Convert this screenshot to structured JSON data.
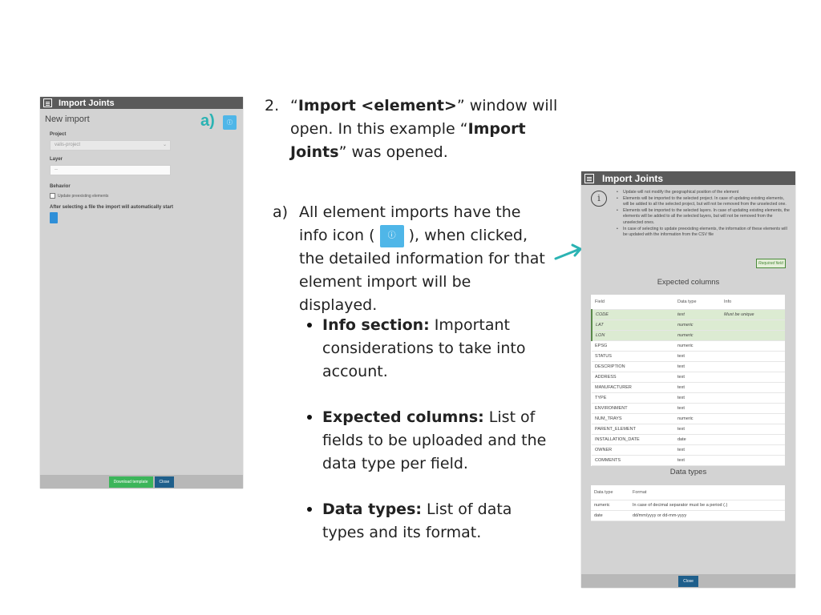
{
  "left_window": {
    "title": "Import Joints",
    "subtitle": "New import",
    "project_label": "Project",
    "project_value": "valis-project",
    "layer_label": "Layer",
    "layer_value": "--",
    "behavior_label": "Behavior",
    "checkbox_label": "Update preexisting elements",
    "auto_text": "After selecting a file the import will automatically start",
    "annotation": "a)",
    "download_label": "Download template",
    "close_label": "Close"
  },
  "step2": {
    "number": "2.",
    "t1": "“",
    "b1": "Import <element>",
    "t2": "” window will open. In this example “",
    "b2": "Import Joints",
    "t3": "” was opened."
  },
  "stepa": {
    "number": "a)",
    "t1": "All element imports have the info icon (",
    "t2": "), when clicked, the detailed information for that element import will be displayed."
  },
  "bullets": [
    {
      "bold": "Info section:",
      "text": " Important considerations to take into account."
    },
    {
      "bold": "Expected columns:",
      "text": " List of fields to be uploaded and the data type per field."
    },
    {
      "bold": "Data types:",
      "text": " List of data types and its format."
    }
  ],
  "right_window": {
    "title": "Import Joints",
    "info_items": [
      "Update will not modify the geographical position of the element",
      "Elements will be imported to the selected project. In case of updating existing elements, will be added to all the selected project, but will not be removed from the unselected one.",
      "Elements will be imported to the selected layers. In case of updating existing elements, the elements will be added to all the selected layers, but will not be removed from the unselected ones.",
      "In case of selecting to update preexisting elements, the information of these elements will be updated with the information from the CSV file"
    ],
    "required_field": "Required field",
    "expected_title": "Expected columns",
    "columns_header": [
      "Field",
      "Data type",
      "Info"
    ],
    "columns": [
      {
        "field": "CODE",
        "type": "text",
        "info": "Must be unique",
        "required": true
      },
      {
        "field": "LAT",
        "type": "numeric",
        "info": "",
        "required": true
      },
      {
        "field": "LON",
        "type": "numeric",
        "info": "",
        "required": true
      },
      {
        "field": "EPSG",
        "type": "numeric",
        "info": "",
        "required": false
      },
      {
        "field": "STATUS",
        "type": "text",
        "info": "",
        "required": false
      },
      {
        "field": "DESCRIPTION",
        "type": "text",
        "info": "",
        "required": false
      },
      {
        "field": "ADDRESS",
        "type": "text",
        "info": "",
        "required": false
      },
      {
        "field": "MANUFACTURER",
        "type": "text",
        "info": "",
        "required": false
      },
      {
        "field": "TYPE",
        "type": "text",
        "info": "",
        "required": false
      },
      {
        "field": "ENVIRONMENT",
        "type": "text",
        "info": "",
        "required": false
      },
      {
        "field": "NUM_TRAYS",
        "type": "numeric",
        "info": "",
        "required": false
      },
      {
        "field": "PARENT_ELEMENT",
        "type": "text",
        "info": "",
        "required": false
      },
      {
        "field": "INSTALLATION_DATE",
        "type": "date",
        "info": "",
        "required": false
      },
      {
        "field": "OWNER",
        "type": "text",
        "info": "",
        "required": false
      },
      {
        "field": "COMMENTS",
        "type": "text",
        "info": "",
        "required": false
      }
    ],
    "types_title": "Data types",
    "types_header": [
      "Data type",
      "Format"
    ],
    "types": [
      {
        "type": "numeric",
        "format": "In case of decimal separator must be a period (.)"
      },
      {
        "type": "date",
        "format": "dd/mm/yyyy or dd-mm-yyyy"
      }
    ],
    "close_label": "Close"
  },
  "colors": {
    "accent_teal": "#2bb3b3",
    "info_blue": "#4fb6e8",
    "close_blue": "#1f5f8b",
    "download_green": "#3cb55a"
  }
}
